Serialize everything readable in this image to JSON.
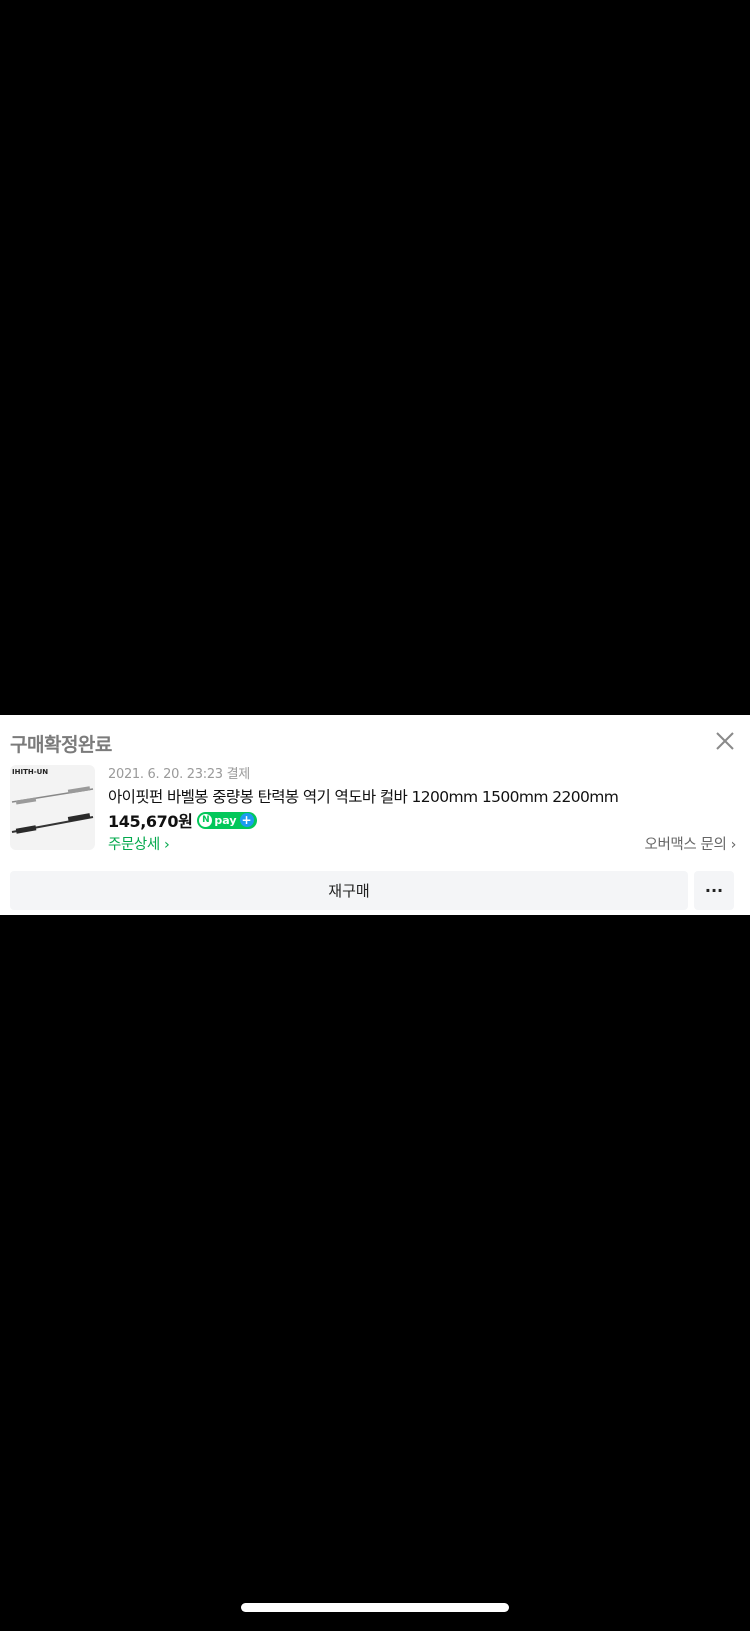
{
  "card": {
    "status_title": "구매확정완료",
    "close_icon": "close-icon",
    "product": {
      "thumbnail_brand": "IHITH-UN",
      "order_date": "2021. 6. 20. 23:23 결제",
      "name": "아이핏펀 바벨봉 중량봉 탄력봉 역기 역도바 컬바 1200mm 1500mm 2200mm",
      "price": "145,670원",
      "npay_label": "pay",
      "npay_n": "N",
      "npay_plus": "+"
    },
    "order_detail_label": "주문상세 ›",
    "seller_inquiry_label": "오버맥스 문의 ›",
    "rebuy_label": "재구매",
    "more_label": "···"
  },
  "colors": {
    "accent_green": "#03a94d",
    "npay_green": "#03c75a",
    "npay_blue": "#1e9bf0",
    "button_bg": "#f4f5f7"
  }
}
